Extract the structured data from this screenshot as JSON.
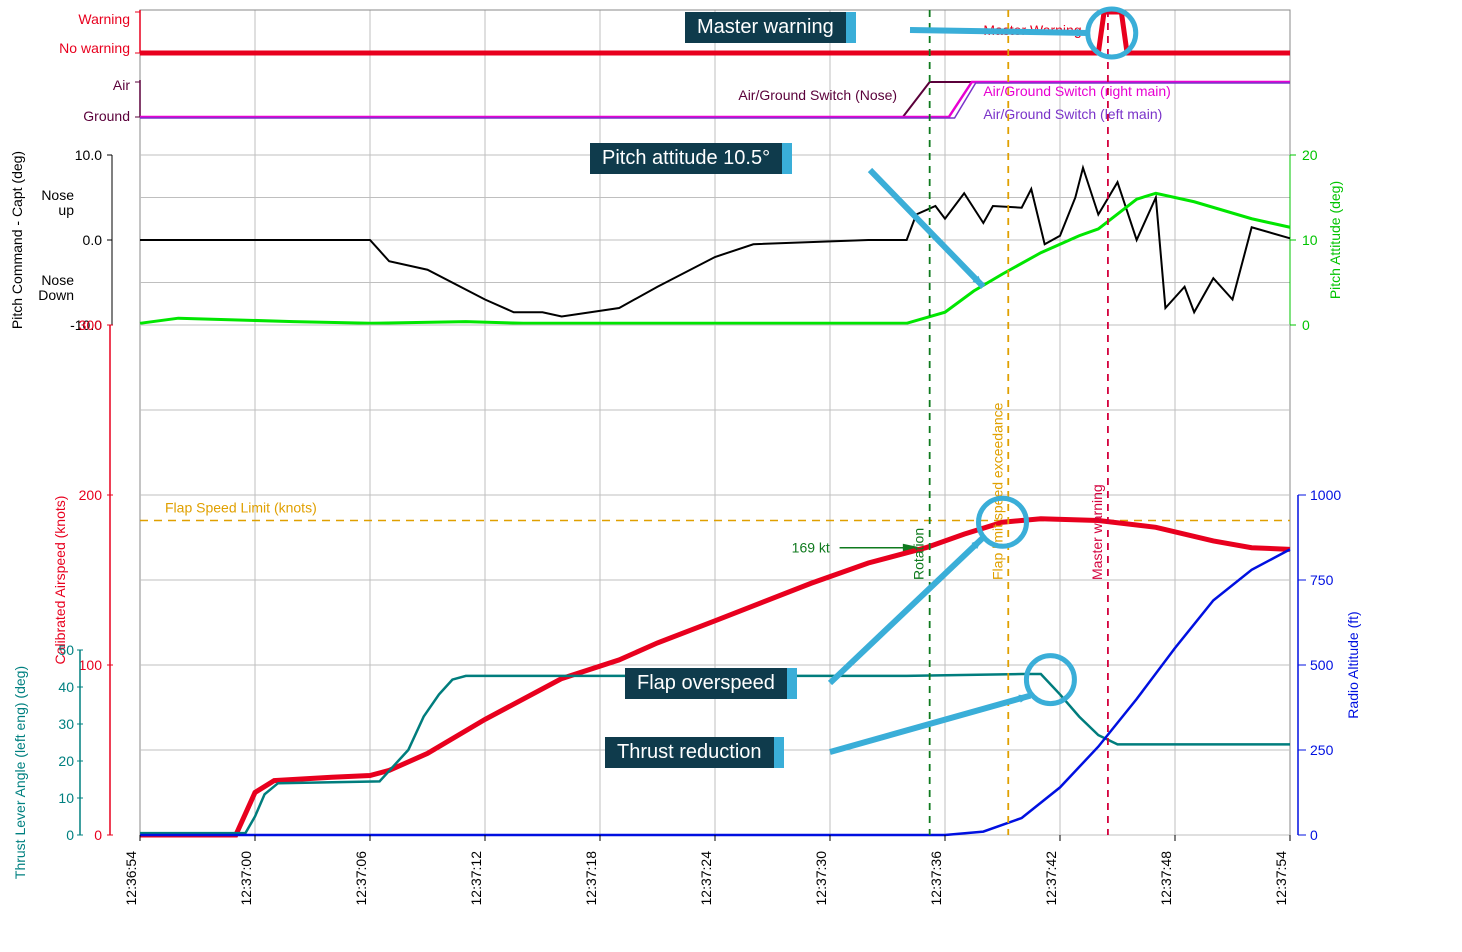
{
  "chart_data": {
    "type": "line",
    "time_start": "12:36:54",
    "time_end": "12:37:54",
    "x_ticks": [
      "12:36:54",
      "12:37:00",
      "12:37:06",
      "12:37:12",
      "12:37:18",
      "12:37:24",
      "12:37:30",
      "12:37:36",
      "12:37:42",
      "12:37:48",
      "12:37:54"
    ],
    "panels": [
      {
        "name": "warning",
        "y_left_label": "",
        "y_left_ticks": [
          "No warning",
          "Warning"
        ],
        "series": [
          {
            "name": "Master Warning",
            "color": "#e8001e",
            "label_inline": "Master Warning"
          }
        ]
      },
      {
        "name": "airground",
        "y_left_label": "",
        "y_left_ticks": [
          "Ground",
          "Air"
        ],
        "series": [
          {
            "name": "Nose",
            "color": "#5a003a",
            "label_inline": "Air/Ground Switch (Nose)"
          },
          {
            "name": "Right main",
            "color": "#e800d2",
            "label_inline": "Air/Ground Switch (right main)"
          },
          {
            "name": "Left main",
            "color": "#7a33c9",
            "label_inline": "Air/Ground Switch (left main)"
          }
        ]
      },
      {
        "name": "pitch",
        "y_left_label": "Pitch Command - Capt (deg)",
        "y_left_ticks": [
          -10.0,
          0.0,
          10.0
        ],
        "y_left_extra_labels": [
          "Nose Down",
          "Nose up"
        ],
        "y_right_label": "Pitch Attitude (deg)",
        "y_right_ticks": [
          0,
          10,
          20
        ],
        "series": [
          {
            "name": "Pitch Command",
            "color": "#000000",
            "data": [
              {
                "t": 0,
                "v": 0
              },
              {
                "t": 7,
                "v": 0
              },
              {
                "t": 12,
                "v": 0
              },
              {
                "t": 13,
                "v": -2.5
              },
              {
                "t": 15,
                "v": -3.5
              },
              {
                "t": 18,
                "v": -7
              },
              {
                "t": 19.5,
                "v": -8.5
              },
              {
                "t": 21,
                "v": -8.5
              },
              {
                "t": 22,
                "v": -9
              },
              {
                "t": 25,
                "v": -8
              },
              {
                "t": 27,
                "v": -5.5
              },
              {
                "t": 30,
                "v": -2
              },
              {
                "t": 32,
                "v": -0.5
              },
              {
                "t": 38,
                "v": 0
              },
              {
                "t": 40,
                "v": 0
              },
              {
                "t": 40.5,
                "v": 3
              },
              {
                "t": 41.5,
                "v": 4.0
              },
              {
                "t": 42,
                "v": 2.5
              },
              {
                "t": 43,
                "v": 5.5
              },
              {
                "t": 44,
                "v": 2
              },
              {
                "t": 44.5,
                "v": 4
              },
              {
                "t": 46,
                "v": 3.8
              },
              {
                "t": 46.5,
                "v": 6
              },
              {
                "t": 47.2,
                "v": -0.5
              },
              {
                "t": 48,
                "v": 0.5
              },
              {
                "t": 48.8,
                "v": 5
              },
              {
                "t": 49.2,
                "v": 8.5
              },
              {
                "t": 50,
                "v": 3
              },
              {
                "t": 51,
                "v": 6.8
              },
              {
                "t": 52,
                "v": 0
              },
              {
                "t": 53,
                "v": 5
              },
              {
                "t": 53.5,
                "v": -8
              },
              {
                "t": 54.5,
                "v": -5.5
              },
              {
                "t": 55,
                "v": -8.5
              },
              {
                "t": 56,
                "v": -4.5
              },
              {
                "t": 57,
                "v": -7
              },
              {
                "t": 58,
                "v": 1.5
              },
              {
                "t": 60,
                "v": 0.2
              }
            ]
          },
          {
            "name": "Pitch Attitude",
            "color": "#00e600",
            "data": [
              {
                "t": 0,
                "v": 0.2
              },
              {
                "t": 2,
                "v": 0.8
              },
              {
                "t": 8,
                "v": 0.4
              },
              {
                "t": 12,
                "v": 0.2
              },
              {
                "t": 17,
                "v": 0.4
              },
              {
                "t": 20,
                "v": 0.2
              },
              {
                "t": 40,
                "v": 0.2
              },
              {
                "t": 42,
                "v": 1.5
              },
              {
                "t": 43.5,
                "v": 4
              },
              {
                "t": 45,
                "v": 6
              },
              {
                "t": 47,
                "v": 8.5
              },
              {
                "t": 49,
                "v": 10.5
              },
              {
                "t": 50,
                "v": 11.3
              },
              {
                "t": 52,
                "v": 14.8
              },
              {
                "t": 53,
                "v": 15.5
              },
              {
                "t": 55,
                "v": 14.5
              },
              {
                "t": 58,
                "v": 12.5
              },
              {
                "t": 60,
                "v": 11.5
              }
            ]
          }
        ]
      },
      {
        "name": "main",
        "y_left_label": "Calibrated Airspeed (knots)",
        "y_left_ticks": [
          0,
          100,
          200,
          300
        ],
        "y_left2_label": "Thrust Lever Angle (left eng) (deg)",
        "y_left2_ticks": [
          0,
          10,
          20,
          30,
          40,
          50
        ],
        "y_right_label": "Radio Altitude (ft)",
        "y_right_ticks": [
          0,
          250,
          500,
          750,
          1000
        ],
        "flap_speed_limit_label": "Flap Speed Limit (knots)",
        "flap_speed_limit_value": 185,
        "rotation_speed_label": "169 kt",
        "series": [
          {
            "name": "Calibrated Airspeed",
            "color": "#e8001e",
            "data": [
              {
                "t": 0,
                "v": 0
              },
              {
                "t": 5,
                "v": 0
              },
              {
                "t": 6,
                "v": 25
              },
              {
                "t": 7,
                "v": 32
              },
              {
                "t": 10,
                "v": 34
              },
              {
                "t": 12,
                "v": 35
              },
              {
                "t": 13,
                "v": 38
              },
              {
                "t": 15,
                "v": 48
              },
              {
                "t": 18,
                "v": 68
              },
              {
                "t": 22,
                "v": 92
              },
              {
                "t": 25,
                "v": 103
              },
              {
                "t": 27,
                "v": 113
              },
              {
                "t": 30,
                "v": 126
              },
              {
                "t": 35,
                "v": 148
              },
              {
                "t": 38,
                "v": 160
              },
              {
                "t": 41,
                "v": 169
              },
              {
                "t": 43,
                "v": 177
              },
              {
                "t": 45,
                "v": 184
              },
              {
                "t": 47,
                "v": 186
              },
              {
                "t": 50,
                "v": 185
              },
              {
                "t": 53,
                "v": 181
              },
              {
                "t": 56,
                "v": 173
              },
              {
                "t": 58,
                "v": 169
              },
              {
                "t": 60,
                "v": 168
              }
            ]
          },
          {
            "name": "Thrust Lever Angle",
            "color": "#007d7d",
            "data": [
              {
                "t": 0,
                "v": 0.5
              },
              {
                "t": 5.5,
                "v": 0.5
              },
              {
                "t": 6,
                "v": 5
              },
              {
                "t": 6.5,
                "v": 11
              },
              {
                "t": 7.2,
                "v": 14
              },
              {
                "t": 12.5,
                "v": 14.5
              },
              {
                "t": 14,
                "v": 23
              },
              {
                "t": 14.8,
                "v": 32
              },
              {
                "t": 15.6,
                "v": 38
              },
              {
                "t": 16.3,
                "v": 42
              },
              {
                "t": 17,
                "v": 43
              },
              {
                "t": 40,
                "v": 43
              },
              {
                "t": 46,
                "v": 43.5
              },
              {
                "t": 47,
                "v": 43.5
              },
              {
                "t": 48,
                "v": 38
              },
              {
                "t": 49,
                "v": 32
              },
              {
                "t": 50,
                "v": 27
              },
              {
                "t": 51,
                "v": 24.5
              },
              {
                "t": 60,
                "v": 24.5
              }
            ]
          },
          {
            "name": "Radio Altitude",
            "color": "#0010e0",
            "data": [
              {
                "t": 0,
                "v": 0
              },
              {
                "t": 40,
                "v": 0
              },
              {
                "t": 42,
                "v": 0
              },
              {
                "t": 44,
                "v": 10
              },
              {
                "t": 46,
                "v": 50
              },
              {
                "t": 48,
                "v": 140
              },
              {
                "t": 50,
                "v": 260
              },
              {
                "t": 52,
                "v": 400
              },
              {
                "t": 54,
                "v": 550
              },
              {
                "t": 56,
                "v": 690
              },
              {
                "t": 58,
                "v": 780
              },
              {
                "t": 60,
                "v": 840
              }
            ]
          }
        ]
      }
    ],
    "vertical_markers": [
      {
        "label": "Rotation",
        "color": "#0f7a1e",
        "t": 41.2
      },
      {
        "label": "Flap limit speed exceedance",
        "color": "#e0a000",
        "t": 45.3
      },
      {
        "label": "Master warning",
        "color": "#d4003c",
        "t": 50.5
      }
    ],
    "annotations": [
      {
        "text": "Master warning"
      },
      {
        "text": "Pitch attitude 10.5°"
      },
      {
        "text": "Flap overspeed"
      },
      {
        "text": "Thrust reduction"
      }
    ]
  },
  "colors": {
    "grid": "#bfbfbf",
    "border": "#888888",
    "callout": "#3aaed8",
    "calloutBg": "#0f3b4c"
  }
}
